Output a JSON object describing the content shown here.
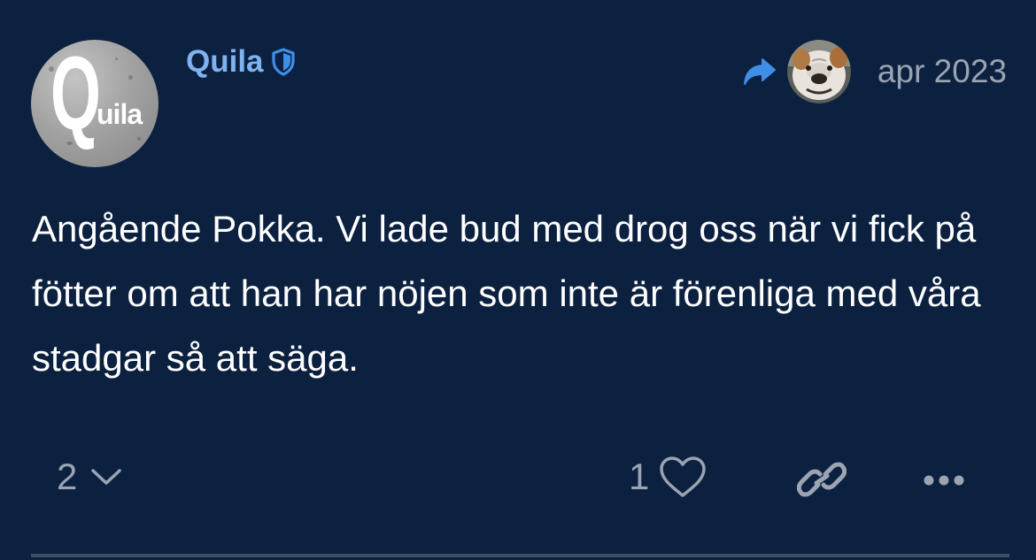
{
  "post": {
    "author": {
      "name": "Quila",
      "avatar_text_big": "Q",
      "avatar_text_small": "uila",
      "badge_icon": "shield-icon"
    },
    "reply_to": {
      "arrow_icon": "reply-arrow-icon",
      "avatar_icon": "bulldog-avatar"
    },
    "date": "apr 2023",
    "body": "Angående Pokka. Vi lade bud med drog oss när vi fick på fötter om att han har nöjen som inte är förenliga med våra stadgar så att säga.",
    "replies_count": "2",
    "likes_count": "1",
    "colors": {
      "background": "#0c2140",
      "username": "#7fb2f0",
      "accent": "#3f8fe8",
      "muted": "#9aa4b2"
    }
  }
}
